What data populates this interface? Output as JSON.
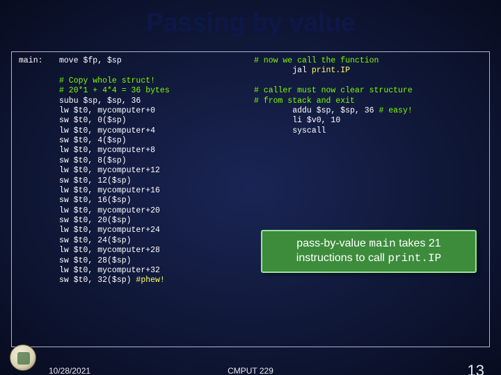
{
  "title": "Passing by value",
  "label_main": "main:",
  "left": {
    "l1": "move $fp, $sp",
    "c1": "# Copy whole struct!",
    "c2": "# 20*1 + 4*4 = 36 bytes",
    "l2": "subu $sp, $sp, 36",
    "lw0": "lw $t0, mycomputer+0",
    "sw0": "sw $t0, 0($sp)",
    "lw4": "lw $t0, mycomputer+4",
    "sw4": "sw $t0, 4($sp)",
    "lw8": "lw $t0, mycomputer+8",
    "sw8": "sw $t0, 8($sp)",
    "lw12": "lw $t0, mycomputer+12",
    "sw12": "sw $t0, 12($sp)",
    "lw16": "lw $t0, mycomputer+16",
    "sw16": "sw $t0, 16($sp)",
    "lw20": "lw $t0, mycomputer+20",
    "sw20": "sw $t0, 20($sp)",
    "lw24": "lw $t0, mycomputer+24",
    "sw24": "sw $t0, 24($sp)",
    "lw28": "lw $t0, mycomputer+28",
    "sw28": "sw $t0, 28($sp)",
    "lw32": "lw $t0, mycomputer+32",
    "sw32_a": "sw $t0, 32($sp) ",
    "sw32_b": "#phew!"
  },
  "right": {
    "c1": "# now we call the function",
    "jal_a": "        jal ",
    "jal_b": "print.IP",
    "c3": "# caller must now clear structure",
    "c4": "# from stack and exit",
    "addu": "        addu $sp, $sp, 36 ",
    "addu_c": "# easy!",
    "li": "        li $v0, 10",
    "sys": "        syscall"
  },
  "callout": {
    "a": "pass-by-value ",
    "b": "main",
    "c": " takes 21 instructions to call ",
    "d": "print.IP"
  },
  "footer": {
    "date": "10/28/2021",
    "course": "CMPUT 229",
    "page": "13"
  }
}
